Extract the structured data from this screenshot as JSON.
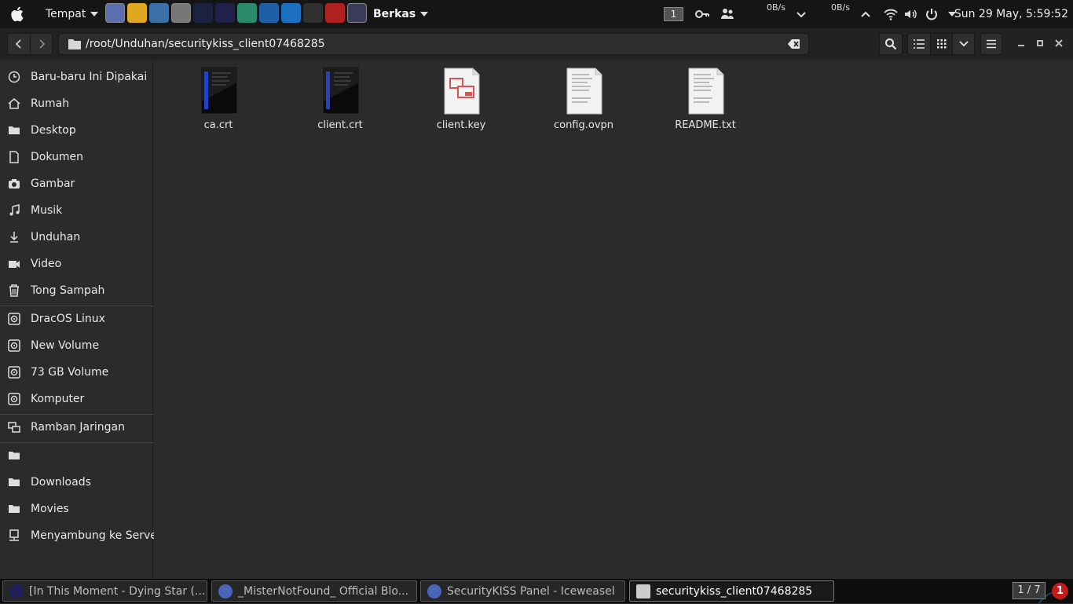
{
  "top_panel": {
    "places_menu": "Tempat",
    "active_app": "Berkas",
    "workspace": "1",
    "net_down": "0B/s",
    "net_up": "0B/s",
    "clock": "Sun 29 May,  5:59:52"
  },
  "launchers": [
    {
      "name": "iceweasel-launcher",
      "color": "#5a6fb0"
    },
    {
      "name": "chrome-launcher",
      "color": "#e0a820"
    },
    {
      "name": "chat-launcher",
      "color": "#3a6fa8"
    },
    {
      "name": "files-launcher",
      "color": "#777777"
    },
    {
      "name": "terminal-launcher",
      "color": "#1b2240"
    },
    {
      "name": "darkstar-launcher",
      "color": "#202048"
    },
    {
      "name": "hacker-launcher",
      "color": "#2a8a6a"
    },
    {
      "name": "metasploit-launcher",
      "color": "#1e5fa8"
    },
    {
      "name": "teamviewer-launcher",
      "color": "#1d6fc0"
    },
    {
      "name": "spider-launcher",
      "color": "#303030"
    },
    {
      "name": "cm-launcher",
      "color": "#b02020"
    },
    {
      "name": "dracos-launcher",
      "color": "#3a3a5a"
    }
  ],
  "headerbar": {
    "path": "/root/Unduhan/securitykiss_client07468285"
  },
  "sidebar": {
    "items": [
      {
        "label": "Baru-baru Ini Dipakai",
        "icon": "clock-icon"
      },
      {
        "label": "Rumah",
        "icon": "home-icon"
      },
      {
        "label": "Desktop",
        "icon": "folder-icon"
      },
      {
        "label": "Dokumen",
        "icon": "document-icon"
      },
      {
        "label": "Gambar",
        "icon": "camera-icon"
      },
      {
        "label": "Musik",
        "icon": "music-icon"
      },
      {
        "label": "Unduhan",
        "icon": "download-icon"
      },
      {
        "label": "Video",
        "icon": "video-icon"
      },
      {
        "label": "Tong Sampah",
        "icon": "trash-icon"
      }
    ],
    "devices": [
      {
        "label": "DracOS Linux",
        "icon": "drive-icon"
      },
      {
        "label": "New Volume",
        "icon": "drive-icon"
      },
      {
        "label": "73 GB Volume",
        "icon": "drive-icon"
      },
      {
        "label": "Komputer",
        "icon": "drive-icon"
      }
    ],
    "network": [
      {
        "label": "Ramban Jaringan",
        "icon": "network-icon"
      }
    ],
    "bookmarks": [
      {
        "label": "",
        "icon": "folder-icon"
      },
      {
        "label": "Downloads",
        "icon": "folder-icon"
      },
      {
        "label": "Movies",
        "icon": "folder-icon"
      },
      {
        "label": "Menyambung ke Server",
        "icon": "server-icon"
      }
    ]
  },
  "files": [
    {
      "name": "ca.crt",
      "type": "certificate"
    },
    {
      "name": "client.crt",
      "type": "certificate"
    },
    {
      "name": "client.key",
      "type": "key"
    },
    {
      "name": "config.ovpn",
      "type": "text"
    },
    {
      "name": "README.txt",
      "type": "text"
    }
  ],
  "taskbar": {
    "tasks": [
      {
        "label": "[In This Moment - Dying Star (...",
        "active": false
      },
      {
        "label": "_MisterNotFound_ Official Blo...",
        "active": false
      },
      {
        "label": "SecurityKISS Panel - Iceweasel",
        "active": false
      },
      {
        "label": "securitykiss_client07468285",
        "active": true
      }
    ],
    "pager": "1 / 7",
    "notifications": "1"
  }
}
